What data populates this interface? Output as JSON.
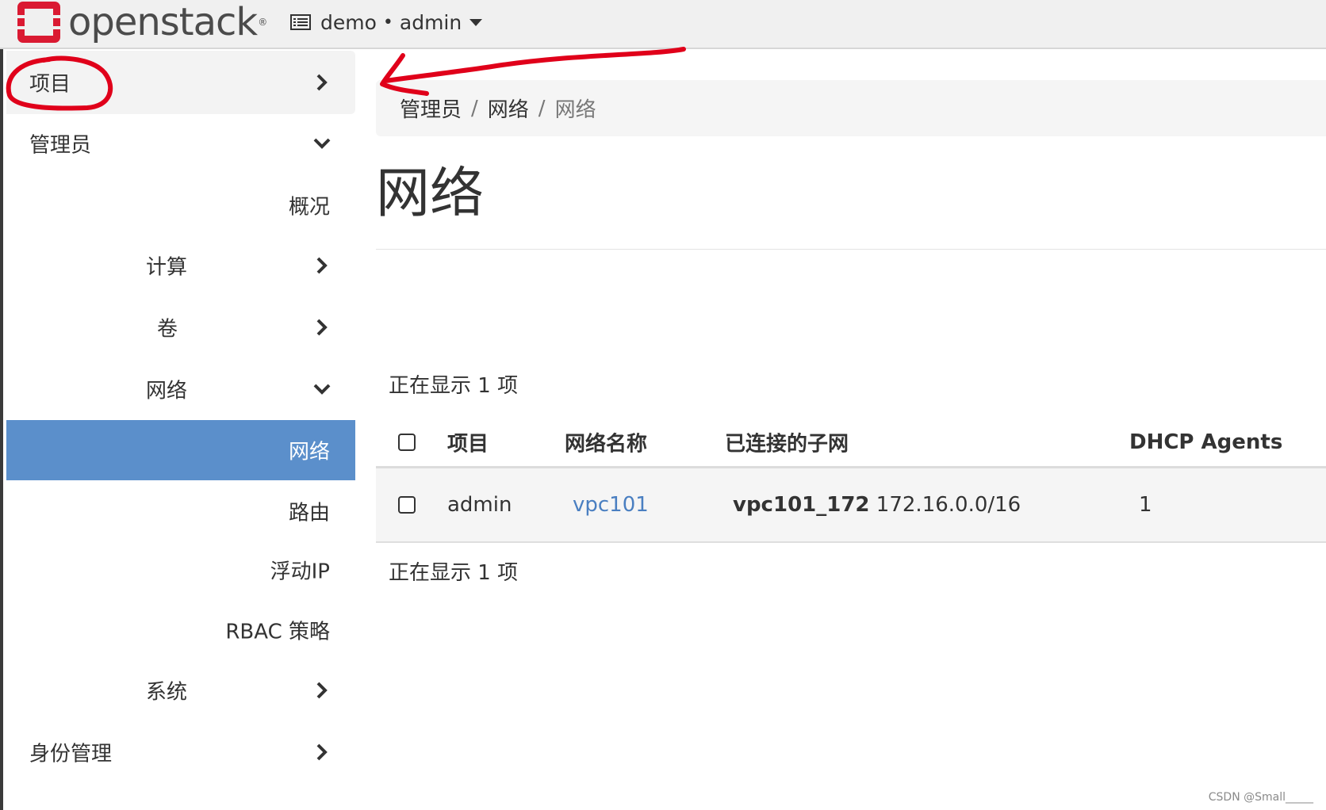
{
  "navbar": {
    "brand": "openstack",
    "brand_mark": "®",
    "project_label": "demo",
    "separator": "•",
    "user_label": "admin",
    "brand_color": "#da1a32"
  },
  "sidebar": {
    "project": "项目",
    "admin": "管理员",
    "overview": "概况",
    "compute": "计算",
    "volumes": "卷",
    "network_group": "网络",
    "networks": "网络",
    "routers": "路由",
    "floating_ip": "浮动IP",
    "rbac": "RBAC 策略",
    "system": "系统",
    "identity": "身份管理",
    "active_color": "#5b8fcb"
  },
  "breadcrumb": {
    "items": [
      "管理员",
      "网络",
      "网络"
    ],
    "divider": "/"
  },
  "page": {
    "title": "网络",
    "count_top": "正在显示 1 项",
    "count_bottom": "正在显示 1 项"
  },
  "table": {
    "headers": [
      "项目",
      "网络名称",
      "已连接的子网",
      "DHCP Agents"
    ],
    "rows": [
      {
        "project": "admin",
        "name": "vpc101",
        "subnet_name": "vpc101_172",
        "subnet_cidr": "172.16.0.0/16",
        "dhcp_agents": "1"
      }
    ]
  },
  "watermark": "CSDN @Small_____",
  "annotation_color": "#e0001a"
}
